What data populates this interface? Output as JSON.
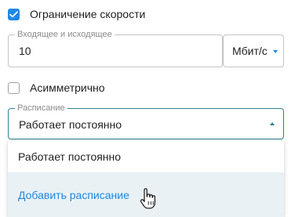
{
  "speed_limit": {
    "label": "Ограничение скорости",
    "checked": true
  },
  "bandwidth": {
    "legend": "Входящее и исходящее",
    "value": "10",
    "unit": "Мбит/с"
  },
  "asymmetric": {
    "label": "Асимметрично",
    "checked": false
  },
  "schedule": {
    "legend": "Расписание",
    "selected": "Работает постоянно",
    "options": [
      "Работает постоянно",
      "Добавить расписание"
    ]
  },
  "colors": {
    "accent": "#1e88e5",
    "focus": "#2f7f8c",
    "hover_bg": "#e9f1f4"
  },
  "icons": {
    "checkmark": "checkmark-icon",
    "unit_caret": "caret-down-icon",
    "schedule_caret": "caret-up-icon",
    "cursor": "hand-pointer-icon"
  }
}
